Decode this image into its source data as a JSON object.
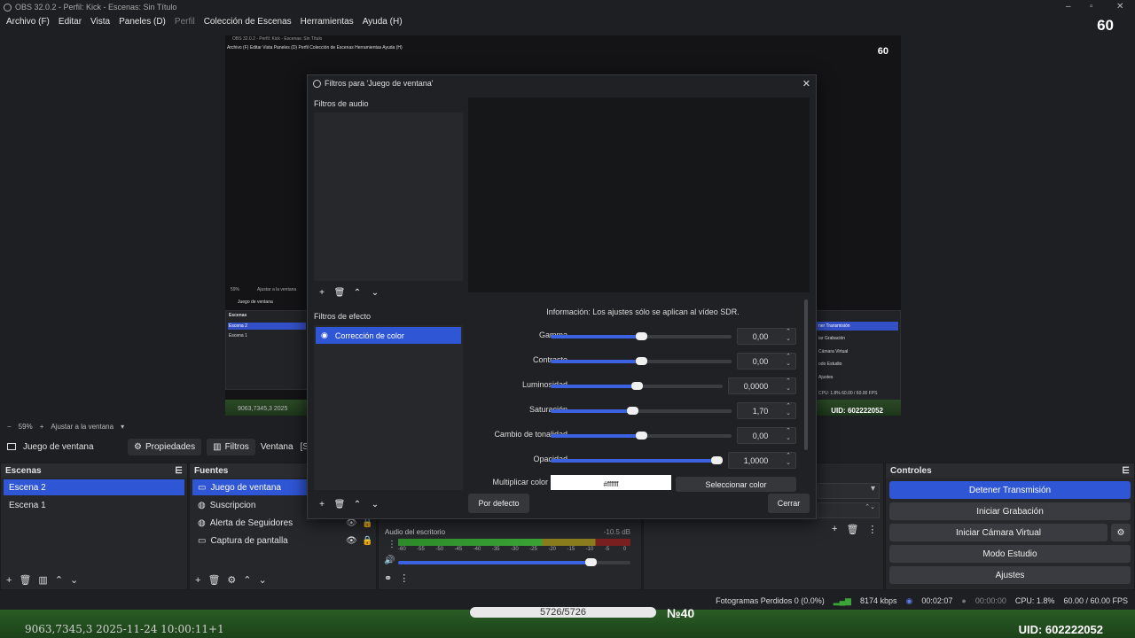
{
  "window": {
    "title": "OBS 32.0.2 - Perfil: Kick - Escenas: Sin Título",
    "fps_overlay": "60"
  },
  "menu": [
    "Archivo (F)",
    "Editar",
    "Vista",
    "Paneles (D)",
    "Perfil",
    "Colección de Escenas",
    "Herramientas",
    "Ayuda (H)"
  ],
  "preview": {
    "inner_title": "OBS 32.0.2 - Perfil: Kick - Escenas: Sin Título",
    "inner_menu": "Archivo (F)   Editar   Vista   Paneles (D)   Perfil   Colección de Escenas   Herramientas   Ayuda (H)",
    "inner_fps": "60",
    "inner_zoom": "59%",
    "inner_fit": "Ajustar a la ventana",
    "inner_source": "Juego de ventana",
    "inner_scenes_title": "Escenas",
    "inner_scene_1": "Escena 2",
    "inner_scene_2": "Escena 1",
    "inner_ctrl": [
      "ner Transmisión",
      "iar Grabación",
      "Cámara Virtual",
      "odo Estudio",
      "Ajustes"
    ],
    "inner_status": "CPU: 1.8%   60.00 / 60.00 FPS",
    "inner_uid": "UID: 602222052",
    "inner_coords": "9063,7345,3   2025"
  },
  "zoom": {
    "percent": "59%",
    "fit_label": "Ajustar a la ventana"
  },
  "source_toolbar": {
    "source_name": "Juego de ventana",
    "properties": "Propiedades",
    "filters": "Filtros",
    "window_label": "Ventana",
    "window_value": "[Se"
  },
  "scenes": {
    "title": "Escenas",
    "items": [
      "Escena 2",
      "Escena 1"
    ]
  },
  "sources": {
    "title": "Fuentes",
    "items": [
      "Juego de ventana",
      "Suscripcion",
      "Alerta de Seguidores",
      "Captura de pantalla"
    ]
  },
  "mixer": {
    "track": "Audio del escritorio",
    "db": "-10.5 dB",
    "scale": [
      "-60",
      "-55",
      "-50",
      "-45",
      "-40",
      "-35",
      "-30",
      "-25",
      "-20",
      "-15",
      "-10",
      "-5",
      "0"
    ],
    "volume_fraction": 0.83
  },
  "controls": {
    "title": "Controles",
    "buttons": [
      "Detener Transmisión",
      "Iniciar Grabación",
      "Iniciar Cámara Virtual",
      "Modo Estudio",
      "Ajustes"
    ]
  },
  "status": {
    "dropped": "Fotogramas Perdidos 0 (0.0%)",
    "bitrate": "8174 kbps",
    "stream_time": "00:02:07",
    "rec_time": "00:00:00",
    "cpu": "CPU: 1.8%",
    "fps": "60.00 / 60.00 FPS"
  },
  "overlay": {
    "coords": "9063,7345,3   2025-11-24 10:00:11+1",
    "counter": "5726/5726",
    "level": "№40",
    "uid": "UID: 602222052"
  },
  "dialog": {
    "title": "Filtros para 'Juego de ventana'",
    "audio_filters_label": "Filtros de audio",
    "effect_filters_label": "Filtros de efecto",
    "effect_filters": [
      "Corrección de color"
    ],
    "info": "Información: Los ajustes sólo se aplican al vídeo SDR.",
    "params": [
      {
        "label": "Gamma",
        "value": "0,00",
        "fraction": 0.5
      },
      {
        "label": "Contraste",
        "value": "0,00",
        "fraction": 0.5
      },
      {
        "label": "Luminosidad",
        "value": "0,0000",
        "fraction": 0.5
      },
      {
        "label": "Saturación",
        "value": "1,70",
        "fraction": 0.45
      },
      {
        "label": "Cambio de tonalidad",
        "value": "0,00",
        "fraction": 0.5
      },
      {
        "label": "Opacidad",
        "value": "1,0000",
        "fraction": 1.0
      }
    ],
    "multiply_color_label": "Multiplicar color",
    "multiply_color_value": "#ffffff",
    "select_color": "Seleccionar color",
    "defaults_button": "Por defecto",
    "close_button": "Cerrar"
  }
}
